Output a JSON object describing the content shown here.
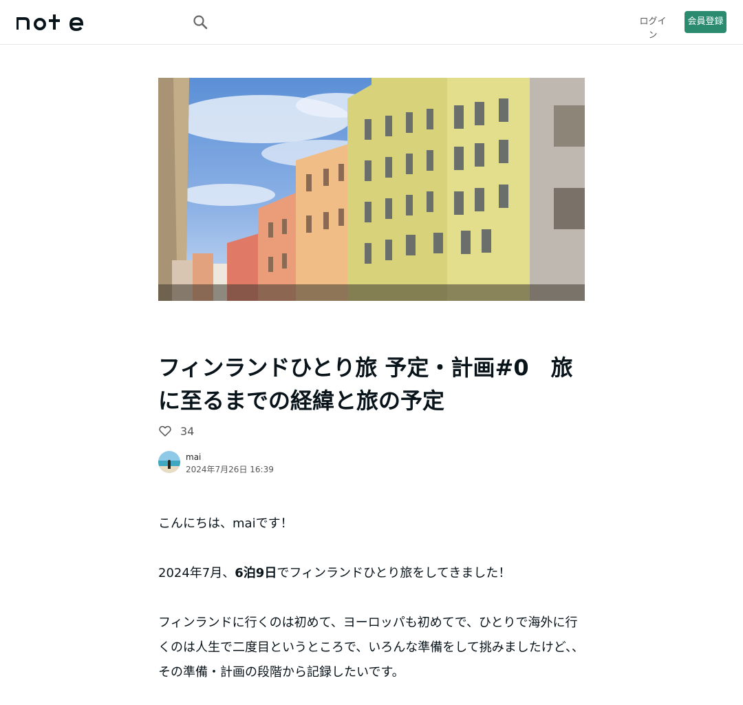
{
  "header": {
    "logo_text": "note",
    "search_icon": "search-icon",
    "login_label": "ログイン",
    "signup_label": "会員登録",
    "accent_color": "#2a8b6f"
  },
  "article": {
    "title": "フィンランドひとり旅 予定・計画#0　旅に至るまでの経緯と旅の予定",
    "like_icon": "heart-outline-icon",
    "like_count": "34",
    "author_name": "mai",
    "post_date": "2024年7月26日 16:39",
    "paragraphs": {
      "p1": "こんにちは、maiです！",
      "p2_pre": "2024年7月、",
      "p2_bold": "6泊9日",
      "p2_post": "でフィンランドひとり旅をしてきました！",
      "p3_line1": "フィンランドに行くのは初めて、ヨーロッパも初めてで、ひとりで海外に行くのは人生で二度目というところで、いろんな準備をして挑",
      "p3_line2": "みましたけど、、",
      "p3_line3": "その準備・計画の段階から記録したいです。"
    }
  }
}
